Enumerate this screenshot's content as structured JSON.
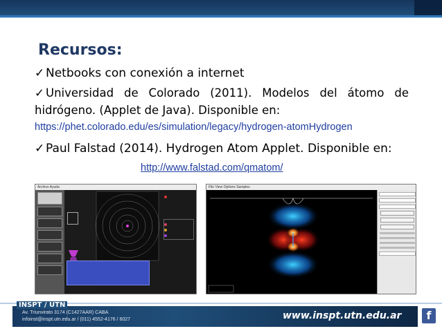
{
  "title": "Recursos:",
  "bullets": {
    "check": "✓",
    "b1": "Netbooks con conexión a internet",
    "b2": "Universidad de Colorado (2011). Modelos del átomo de hidrógeno. (Applet de Java). Disponible en:",
    "b3": "Paul Falstad (2014). Hydrogen Atom Applet. Disponible en:"
  },
  "links": {
    "phet": "https://phet.colorado.edu/es/simulation/legacy/hydrogen-atomHydrogen",
    "falstad": "http://www.falstad.com/qmatom/"
  },
  "shot1": {
    "menu": "Archivo   Ayuda"
  },
  "shot2": {
    "menu": "File   View   Options   Samples"
  },
  "footer": {
    "brand": "INSPT / UTN",
    "addr1": "Av. Triunvirato 3174 (C1427AAR) CABA",
    "addr2": "infoinst@inspt.utn.edu.ar / (011) 4552-4176 / 6027",
    "web": "www.inspt.utn.edu.ar",
    "facebook": "f"
  },
  "colors": {
    "title": "#1f3864",
    "link": "#1f3ea0",
    "banner": "#1f4e79"
  }
}
